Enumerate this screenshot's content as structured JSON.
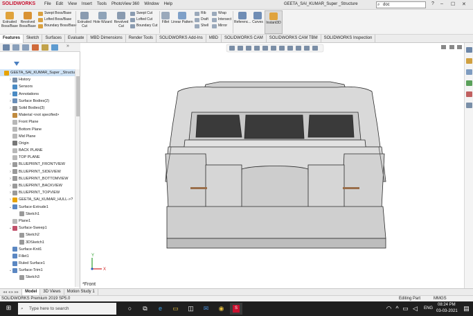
{
  "app": {
    "logo": "SOLIDWORKS",
    "menu": [
      "File",
      "Edit",
      "View",
      "Insert",
      "Tools",
      "PhotoView 360",
      "Window",
      "Help"
    ],
    "document_title": "GEETA_SAI_KUMAR_Super _Structure",
    "search_value": "doc"
  },
  "toolbar": {
    "extruded_boss": "Extruded Boss/Base",
    "revolved_boss": "Revolved Boss/Base",
    "swept_boss": "Swept Boss/Base",
    "lofted_boss": "Lofted Boss/Base",
    "boundary_boss": "Boundary Boss/Base",
    "extruded_cut": "Extruded Cut",
    "hole_wizard": "Hole Wizard",
    "revolved_cut": "Revolved Cut",
    "swept_cut": "Swept Cut",
    "lofted_cut": "Lofted Cut",
    "boundary_cut": "Boundary Cut",
    "fillet": "Fillet",
    "linear_pattern": "Linear Pattern",
    "rib": "Rib",
    "draft": "Draft",
    "shell": "Shell",
    "wrap": "Wrap",
    "intersect": "Intersect",
    "mirror": "Mirror",
    "reference": "Referenc...",
    "curves": "Curves",
    "instant3d": "Instant3D"
  },
  "tabs": [
    "Features",
    "Sketch",
    "Surfaces",
    "Evaluate",
    "MBD Dimensions",
    "Render Tools",
    "SOLIDWORKS Add-Ins",
    "MBD",
    "SOLIDWORKS CAM",
    "SOLIDWORKS CAM TBM",
    "SOLIDWORKS Inspection"
  ],
  "tree": [
    {
      "label": "GEETA_SAI_KUMAR_Super _Structu",
      "arrow": "",
      "level": 0,
      "icon": "part-icon",
      "color": "#e8a300"
    },
    {
      "label": "History",
      "arrow": "›",
      "level": 1,
      "icon": "history-icon",
      "color": "#7a8fa8"
    },
    {
      "label": "Sensors",
      "arrow": "",
      "level": 1,
      "icon": "sensor-icon",
      "color": "#4a8bc4"
    },
    {
      "label": "Annotations",
      "arrow": "›",
      "level": 1,
      "icon": "annotation-icon",
      "color": "#4a8bc4"
    },
    {
      "label": "Surface Bodies(2)",
      "arrow": "›",
      "level": 1,
      "icon": "surface-body-icon",
      "color": "#6c8fb8"
    },
    {
      "label": "Solid Bodies(3)",
      "arrow": "›",
      "level": 1,
      "icon": "solid-body-icon",
      "color": "#8a8a8a"
    },
    {
      "label": "Material <not specified>",
      "arrow": "",
      "level": 1,
      "icon": "material-icon",
      "color": "#c08a3e"
    },
    {
      "label": "Front Plane",
      "arrow": "",
      "level": 1,
      "icon": "plane-icon",
      "color": "#b8b8b8"
    },
    {
      "label": "Bottom Plane",
      "arrow": "",
      "level": 1,
      "icon": "plane-icon",
      "color": "#b8b8b8"
    },
    {
      "label": "Mid Plane",
      "arrow": "",
      "level": 1,
      "icon": "plane-icon",
      "color": "#b8b8b8"
    },
    {
      "label": "Origin",
      "arrow": "",
      "level": 1,
      "icon": "origin-icon",
      "color": "#777"
    },
    {
      "label": "BACK PLANE",
      "arrow": "",
      "level": 1,
      "icon": "plane-icon",
      "color": "#b8b8b8"
    },
    {
      "label": "TOP PLANE",
      "arrow": "",
      "level": 1,
      "icon": "plane-icon",
      "color": "#b8b8b8"
    },
    {
      "label": "BLUEPRINT_FRONTVIEW",
      "arrow": "›",
      "level": 1,
      "icon": "sketch-icon",
      "color": "#9a9a9a"
    },
    {
      "label": "BLUEPRINT_SIDEVIEW",
      "arrow": "›",
      "level": 1,
      "icon": "sketch-icon",
      "color": "#9a9a9a"
    },
    {
      "label": "BLUEPRINT_BOTTOMVIEW",
      "arrow": "›",
      "level": 1,
      "icon": "sketch-icon",
      "color": "#9a9a9a"
    },
    {
      "label": "BLUEPRINT_BACKVIEW",
      "arrow": "›",
      "level": 1,
      "icon": "sketch-icon",
      "color": "#9a9a9a"
    },
    {
      "label": "BLUEPRINT_TOPVIEW",
      "arrow": "›",
      "level": 1,
      "icon": "sketch-icon",
      "color": "#9a9a9a"
    },
    {
      "label": "GEETA_SAI_KUMAR_HULL->?",
      "arrow": "›",
      "level": 1,
      "icon": "derived-part-icon",
      "color": "#e8a300"
    },
    {
      "label": "Surface-Extrude1",
      "arrow": "⌄",
      "level": 1,
      "icon": "surface-extrude-icon",
      "color": "#5b87c2"
    },
    {
      "label": "Sketch1",
      "arrow": "",
      "level": 2,
      "icon": "sketch-icon",
      "color": "#9a9a9a"
    },
    {
      "label": "Plane1",
      "arrow": "",
      "level": 1,
      "icon": "plane-icon",
      "color": "#b8b8b8"
    },
    {
      "label": "Surface-Sweep1",
      "arrow": "⌄",
      "level": 1,
      "icon": "surface-sweep-icon",
      "color": "#c0506a"
    },
    {
      "label": "Sketch2",
      "arrow": "",
      "level": 2,
      "icon": "sketch-icon",
      "color": "#9a9a9a"
    },
    {
      "label": "3DSketch1",
      "arrow": "",
      "level": 2,
      "icon": "sketch3d-icon",
      "color": "#9a9a9a"
    },
    {
      "label": "Surface-Knit1",
      "arrow": "",
      "level": 1,
      "icon": "surface-knit-icon",
      "color": "#5b87c2"
    },
    {
      "label": "Fillet1",
      "arrow": "",
      "level": 1,
      "icon": "fillet-icon",
      "color": "#5b87c2"
    },
    {
      "label": "Ruled Surface1",
      "arrow": "",
      "level": 1,
      "icon": "ruled-surface-icon",
      "color": "#5b87c2"
    },
    {
      "label": "Surface-Trim1",
      "arrow": "⌄",
      "level": 1,
      "icon": "surface-trim-icon",
      "color": "#5b87c2"
    },
    {
      "label": "Sketch3",
      "arrow": "",
      "level": 2,
      "icon": "sketch-icon",
      "color": "#9a9a9a"
    }
  ],
  "viewport": {
    "view_label": "*Front",
    "axis_x": "X",
    "axis_y": "Y"
  },
  "bottom_tabs": [
    "Model",
    "3D Views",
    "Motion Study 1"
  ],
  "status": {
    "left": "SOLIDWORKS Premium 2019 SP5.0",
    "mode": "Editing Part",
    "units": "MMGS"
  },
  "taskbar": {
    "search_placeholder": "Type here to search",
    "language": "ENG",
    "time": "08:24 PM",
    "date": "03-03-2021"
  },
  "colors": {
    "accent": "#1b6ac9",
    "brand": "#c8102e",
    "model": "#d6d6d6"
  }
}
